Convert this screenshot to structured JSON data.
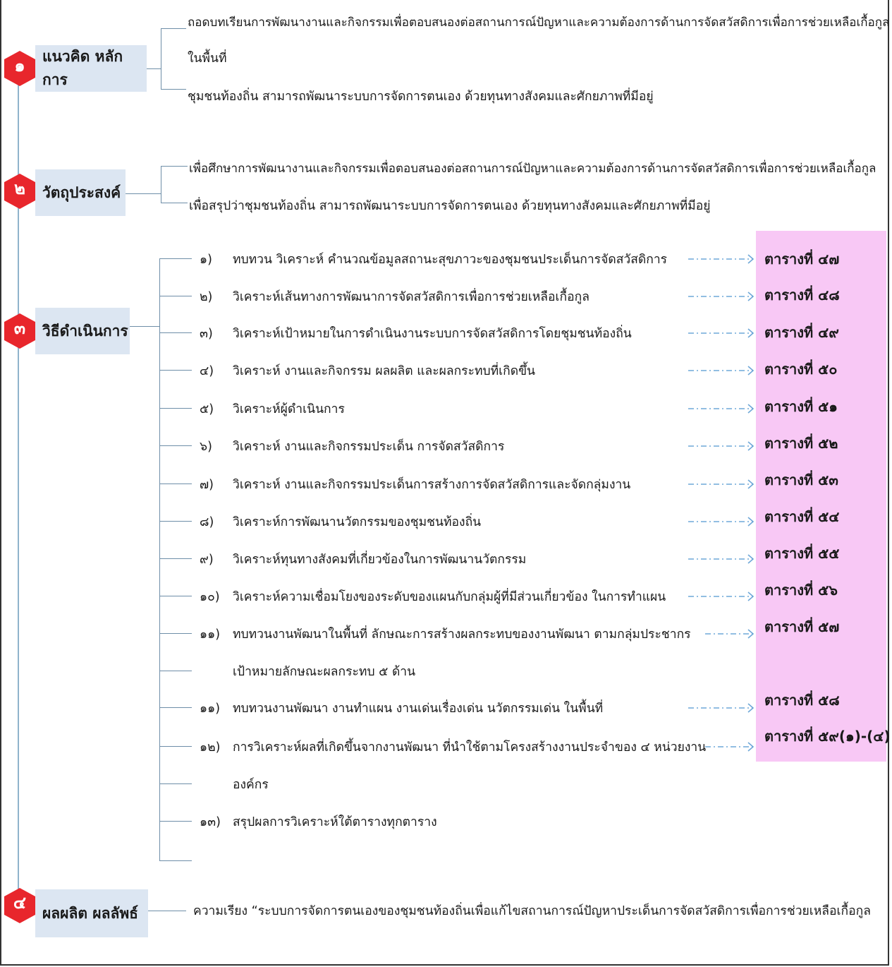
{
  "sections": [
    {
      "number": "๑",
      "label": "แนวคิด หลักการ",
      "lines": [
        "ถอดบทเรียนการพัฒนางานและกิจกรรมเพื่อตอบสนองต่อสถานการณ์ปัญหาและความต้องการด้านการจัดสวัสดิการเพื่อการช่วยเหลือเกื้อกูล",
        "ในพื้นที่",
        "ชุมชนท้องถิ่น สามารถพัฒนาระบบการจัดการตนเอง ด้วยทุนทางสังคมและศักยภาพที่มีอยู่"
      ]
    },
    {
      "number": "๒",
      "label": "วัตถุประสงค์",
      "lines": [
        "เพื่อศึกษาการพัฒนางานและกิจกรรมเพื่อตอบสนองต่อสถานการณ์ปัญหาและความต้องการด้านการจัดสวัสดิการเพื่อการช่วยเหลือเกื้อกูล",
        "เพื่อสรุปว่าชุมชนท้องถิ่น สามารถพัฒนาระบบการจัดการตนเอง ด้วยทุนทางสังคมและศักยภาพที่มีอยู่"
      ]
    },
    {
      "number": "๓",
      "label": "วิธีดำเนินการ"
    },
    {
      "number": "๔",
      "label": "ผลผลิต ผลลัพธ์",
      "lines": [
        "ความเรียง “ระบบการจัดการตนเองของชุมชนท้องถิ่นเพื่อแก้ไขสถานการณ์ปัญหาประเด็นการจัดสวัสดิการเพื่อการช่วยเหลือเกื้อกูล"
      ]
    }
  ],
  "steps": [
    {
      "num": "๑)",
      "text": "ทบทวน วิเคราะห์ คำนวณข้อมูลสถานะสุขภาวะของชุมชนประเด็นการจัดสวัสดิการ",
      "table": "ตารางที่ ๔๗"
    },
    {
      "num": "๒)",
      "text": "วิเคราะห์เส้นทางการพัฒนาการจัดสวัสดิการเพื่อการช่วยเหลือเกื้อกูล",
      "table": "ตารางที่ ๔๘"
    },
    {
      "num": "๓)",
      "text": "วิเคราะห์เป้าหมายในการดำเนินงานระบบการจัดสวัสดิการโดยชุมชนท้องถิ่น",
      "table": "ตารางที่ ๔๙"
    },
    {
      "num": "๔)",
      "text": "วิเคราะห์ งานและกิจกรรม ผลผลิต และผลกระทบที่เกิดขึ้น",
      "table": "ตารางที่ ๕๐"
    },
    {
      "num": "๕)",
      "text": "วิเคราะห์ผู้ดำเนินการ",
      "table": "ตารางที่ ๕๑"
    },
    {
      "num": "๖)",
      "text": "วิเคราะห์ งานและกิจกรรมประเด็น การจัดสวัสดิการ",
      "table": "ตารางที่ ๕๒"
    },
    {
      "num": "๗)",
      "text": "วิเคราะห์ งานและกิจกรรมประเด็นการสร้างการจัดสวัสดิการและจัดกลุ่มงาน",
      "table": "ตารางที่ ๕๓"
    },
    {
      "num": "๘)",
      "text": "วิเคราะห์การพัฒนานวัตกรรมของชุมชนท้องถิ่น",
      "table": "ตารางที่ ๕๔"
    },
    {
      "num": "๙)",
      "text": "วิเคราะห์ทุนทางสังคมที่เกี่ยวข้องในการพัฒนานวัตกรรม",
      "table": "ตารางที่ ๕๕"
    },
    {
      "num": "๑๐)",
      "text": "วิเคราะห์ความเชื่อมโยงของระดับของแผนกับกลุ่มผู้ที่มีส่วนเกี่ยวข้อง ในการทำแผน",
      "table": "ตารางที่ ๕๖"
    },
    {
      "num": "๑๑)",
      "text": "ทบทวนงานพัฒนาในพื้นที่ ลักษณะการสร้างผลกระทบของงานพัฒนา ตามกลุ่มประชากร",
      "cont": "เป้าหมายลักษณะผลกระทบ ๕ ด้าน",
      "table": "ตารางที่ ๕๗"
    },
    {
      "num": "๑๑)",
      "text": "ทบทวนงานพัฒนา งานทำแผน งานเด่นเรื่องเด่น นวัตกรรมเด่น ในพื้นที่",
      "table": "ตารางที่ ๕๘"
    },
    {
      "num": "๑๒)",
      "text": "การวิเคราะห์ผลที่เกิดขึ้นจากงานพัฒนา ที่นำใช้ตามโครงสร้างงานประจำของ ๔ หน่วยงาน",
      "cont": "องค์กร",
      "table": "ตารางที่ ๕๙(๑)-(๔)"
    },
    {
      "num": "๑๓)",
      "text": "สรุปผลการวิเคราะห์ใต้ตารางทุกตาราง"
    }
  ],
  "colors": {
    "marker": "#e8262c",
    "label_bg": "#dce6f2",
    "table_bg": "#f8c8f5",
    "arrow": "#6fa8d8",
    "line": "#6e8ea8"
  }
}
